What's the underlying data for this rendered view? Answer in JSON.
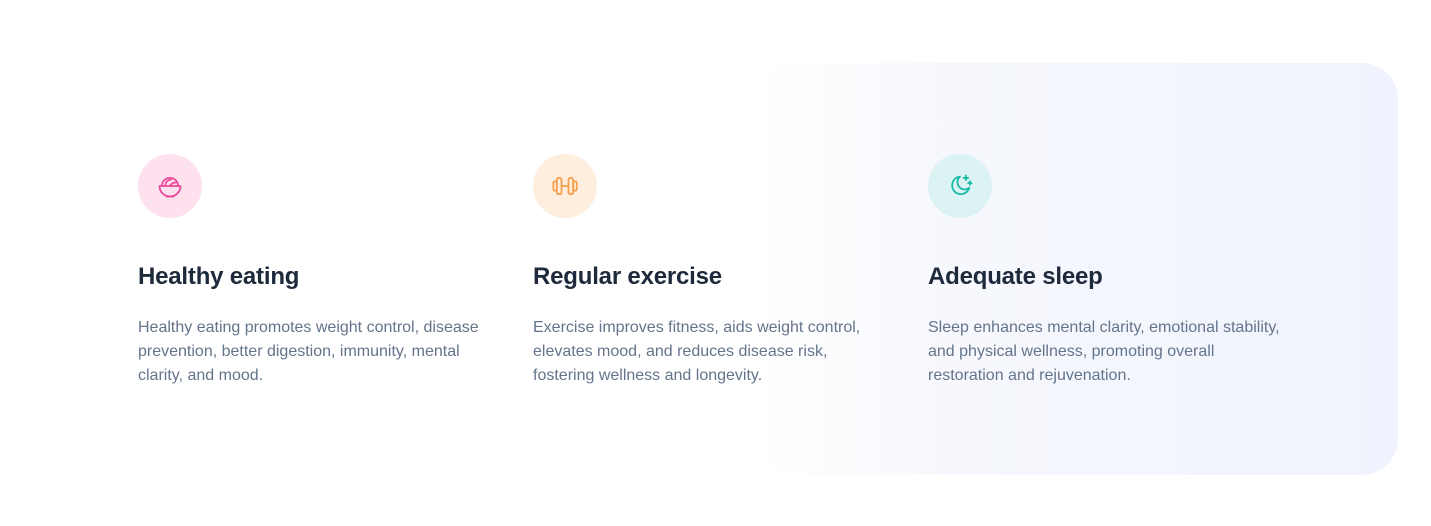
{
  "colors": {
    "pink": "#ec4899",
    "orange": "#f59e4b",
    "teal": "#14b8a6",
    "heading": "#1e293b",
    "body": "#64748b"
  },
  "features": [
    {
      "icon": "bowl-icon",
      "title": "Healthy eating",
      "description": "Healthy eating promotes weight control, disease prevention, better digestion, immunity, mental clarity, and mood."
    },
    {
      "icon": "dumbbell-icon",
      "title": "Regular exercise",
      "description": "Exercise improves fitness, aids weight control, elevates mood, and reduces disease risk, fostering wellness and longevity."
    },
    {
      "icon": "moon-stars-icon",
      "title": "Adequate sleep",
      "description": "Sleep enhances mental clarity, emotional stability, and physical wellness, promoting overall restoration and rejuvenation."
    }
  ]
}
